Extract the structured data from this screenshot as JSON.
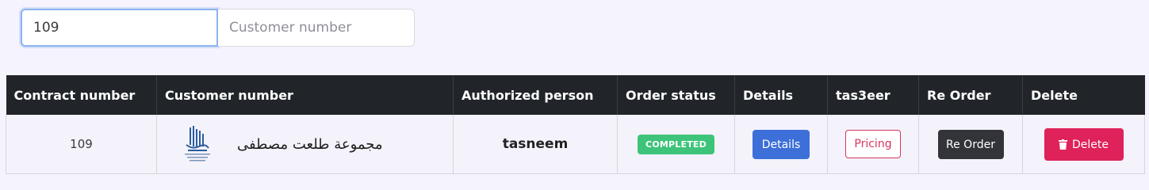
{
  "filters": {
    "contract_value": "109",
    "customer_placeholder": "Customer number"
  },
  "table": {
    "headers": {
      "contract_number": "Contract number",
      "customer_number": "Customer number",
      "authorized_person": "Authorized person",
      "order_status": "Order status",
      "details": "Details",
      "tas3eer": "tas3eer",
      "re_order": "Re Order",
      "delete": "Delete"
    },
    "rows": [
      {
        "contract_number": "109",
        "customer_name": "مجموعة طلعت مصطفى",
        "authorized_person": "tasneem",
        "order_status": "COMPLETED",
        "details_label": "Details",
        "pricing_label": "Pricing",
        "reorder_label": "Re Order",
        "delete_label": "Delete"
      }
    ]
  },
  "colors": {
    "header_bg": "#212529",
    "status_completed": "#3ec47a",
    "details_button": "#3c6fd8",
    "pricing_button": "#d8345f",
    "reorder_button": "#33343a",
    "delete_button": "#df2259"
  },
  "icons": {
    "customer_logo": "building-logo-icon",
    "delete": "trash-icon"
  }
}
